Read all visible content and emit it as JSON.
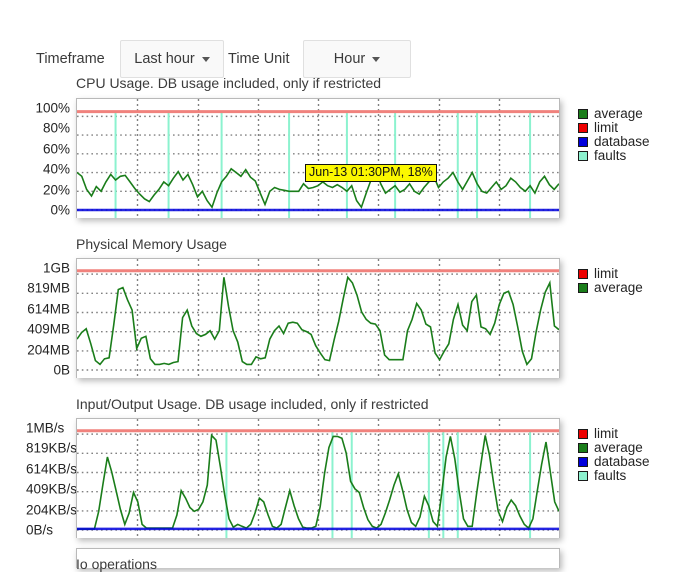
{
  "toolbar": {
    "timeframe_label": "Timeframe",
    "timeframe_value": "Last hour",
    "timeunit_label": "Time Unit",
    "timeunit_value": "Hour"
  },
  "colors": {
    "average": "#1a7d1a",
    "limit": "#ee0000",
    "database": "#0000dd",
    "faults": "#8cf2cf",
    "limit_line": "#f0827d",
    "database_line": "#2222cc",
    "grid": "#808080",
    "plot_border": "#b9b9b9",
    "tooltip_bg": "#fbf800"
  },
  "tooltip": {
    "text": "Jun-13 01:30PM, 18%"
  },
  "charts": [
    {
      "id": "cpu",
      "title": "CPU Usage. DB usage included, only if restricted",
      "yticks": [
        "100%",
        "80%",
        "60%",
        "40%",
        "20%",
        "0%"
      ],
      "legend": [
        {
          "label": "average",
          "color": "#1a7d1a"
        },
        {
          "label": "limit",
          "color": "#ee0000"
        },
        {
          "label": "database",
          "color": "#0000dd"
        },
        {
          "label": "faults",
          "color": "#8cf2cf"
        }
      ]
    },
    {
      "id": "memory",
      "title": "Physical Memory Usage",
      "yticks": [
        "1GB",
        "819MB",
        "614MB",
        "409MB",
        "204MB",
        "0B"
      ],
      "legend": [
        {
          "label": "limit",
          "color": "#ee0000"
        },
        {
          "label": "average",
          "color": "#1a7d1a"
        }
      ]
    },
    {
      "id": "io",
      "title": "Input/Output Usage. DB usage included, only if restricted",
      "yticks": [
        "1MB/s",
        "819KB/s",
        "614KB/s",
        "409KB/s",
        "204KB/s",
        "0B/s"
      ],
      "legend": [
        {
          "label": "limit",
          "color": "#ee0000"
        },
        {
          "label": "average",
          "color": "#1a7d1a"
        },
        {
          "label": "database",
          "color": "#0000dd"
        },
        {
          "label": "faults",
          "color": "#8cf2cf"
        }
      ]
    },
    {
      "id": "io-ops",
      "title": "Io operations",
      "yticks": [],
      "legend": []
    }
  ],
  "chart_data": [
    {
      "type": "line",
      "id": "cpu",
      "title": "CPU Usage. DB usage included, only if restricted",
      "xlabel": "",
      "ylabel": "",
      "ylim": [
        0,
        110
      ],
      "ytick_values": [
        100,
        80,
        60,
        40,
        20,
        0
      ],
      "ytick_labels": [
        "100%",
        "80%",
        "60%",
        "40%",
        "20%",
        "0%"
      ],
      "grid": true,
      "legend_position": "right",
      "limit_value": 105,
      "faults_x": [
        8,
        19,
        30,
        44,
        56,
        66,
        79,
        83,
        94
      ],
      "series": [
        {
          "name": "average",
          "color": "#1a7d1a",
          "values": [
            40,
            36,
            22,
            15,
            25,
            20,
            30,
            38,
            32,
            36,
            37,
            30,
            23,
            17,
            12,
            9,
            16,
            22,
            30,
            26,
            34,
            41,
            32,
            38,
            27,
            14,
            20,
            10,
            3,
            18,
            30,
            36,
            44,
            40,
            36,
            43,
            35,
            31,
            18,
            6,
            20,
            24,
            22,
            21,
            20,
            20,
            20,
            28,
            23,
            24,
            26,
            30,
            26,
            24,
            27,
            24,
            20,
            26,
            10,
            3,
            18,
            32,
            45,
            28,
            18,
            22,
            26,
            19,
            22,
            28,
            20,
            17,
            24,
            30,
            36,
            24,
            30,
            34,
            40,
            30,
            22,
            31,
            40,
            28,
            20,
            18,
            24,
            30,
            22,
            26,
            34,
            30,
            24,
            20,
            26,
            18,
            30,
            36,
            27,
            22,
            28
          ]
        },
        {
          "name": "database",
          "color": "#0000dd",
          "values": [
            0
          ]
        },
        {
          "name": "limit",
          "color": "#ee0000",
          "values": [
            105
          ]
        }
      ]
    },
    {
      "type": "line",
      "id": "memory",
      "title": "Physical Memory Usage",
      "xlabel": "",
      "ylabel": "",
      "ylim": [
        0,
        1100
      ],
      "ytick_values": [
        1024,
        819,
        614,
        409,
        204,
        0
      ],
      "ytick_labels": [
        "1GB",
        "819MB",
        "614MB",
        "409MB",
        "204MB",
        "0B"
      ],
      "grid": true,
      "legend_position": "right",
      "limit_value": 1060,
      "faults_x": [],
      "series": [
        {
          "name": "average",
          "color": "#1a7d1a",
          "values": [
            330,
            400,
            440,
            280,
            100,
            60,
            120,
            130,
            480,
            860,
            880,
            750,
            640,
            230,
            340,
            360,
            120,
            60,
            60,
            70,
            60,
            80,
            90,
            560,
            640,
            470,
            390,
            360,
            380,
            420,
            330,
            420,
            990,
            680,
            420,
            300,
            90,
            60,
            60,
            140,
            120,
            130,
            330,
            420,
            470,
            390,
            500,
            510,
            500,
            430,
            410,
            380,
            260,
            180,
            110,
            100,
            320,
            520,
            760,
            990,
            930,
            800,
            620,
            540,
            500,
            490,
            420,
            160,
            110,
            110,
            110,
            110,
            420,
            540,
            710,
            640,
            490,
            460,
            180,
            110,
            200,
            280,
            540,
            700,
            480,
            420,
            730,
            800,
            460,
            440,
            380,
            500,
            700,
            820,
            840,
            700,
            460,
            200,
            60,
            120,
            400,
            640,
            830,
            930,
            470,
            430
          ]
        },
        {
          "name": "limit",
          "color": "#ee0000",
          "values": [
            1060
          ]
        }
      ]
    },
    {
      "type": "line",
      "id": "io",
      "title": "Input/Output Usage. DB usage included, only if restricted",
      "xlabel": "",
      "ylabel": "",
      "ylim": [
        0,
        1100
      ],
      "ytick_values": [
        1024,
        819,
        614,
        409,
        204,
        0
      ],
      "ytick_labels": [
        "1MB/s",
        "819KB/s",
        "614KB/s",
        "409KB/s",
        "204KB/s",
        "0B/s"
      ],
      "grid": true,
      "legend_position": "right",
      "limit_value": 1060,
      "faults_x": [
        31,
        53,
        57,
        73,
        76,
        79,
        94
      ],
      "series": [
        {
          "name": "average",
          "color": "#1a7d1a",
          "values": [
            10,
            10,
            10,
            10,
            10,
            200,
            500,
            780,
            620,
            420,
            220,
            60,
            180,
            400,
            300,
            60,
            20,
            20,
            20,
            20,
            20,
            20,
            20,
            160,
            420,
            340,
            240,
            200,
            220,
            300,
            480,
            1010,
            960,
            680,
            380,
            120,
            30,
            60,
            40,
            20,
            60,
            180,
            340,
            300,
            160,
            40,
            20,
            60,
            240,
            420,
            260,
            120,
            30,
            20,
            20,
            40,
            250,
            600,
            880,
            1000,
            1000,
            980,
            820,
            520,
            440,
            400,
            240,
            110,
            40,
            20,
            60,
            180,
            320,
            480,
            600,
            420,
            220,
            80,
            40,
            140,
            360,
            260,
            90,
            40,
            400,
            780,
            1000,
            760,
            420,
            120,
            40,
            40,
            380,
            700,
            1010,
            800,
            480,
            200,
            90,
            240,
            320,
            260,
            150,
            60,
            20,
            120,
            420,
            700,
            940,
            620,
            300,
            200
          ]
        },
        {
          "name": "database",
          "color": "#0000dd",
          "values": [
            12
          ]
        },
        {
          "name": "limit",
          "color": "#ee0000",
          "values": [
            1060
          ]
        }
      ]
    }
  ]
}
